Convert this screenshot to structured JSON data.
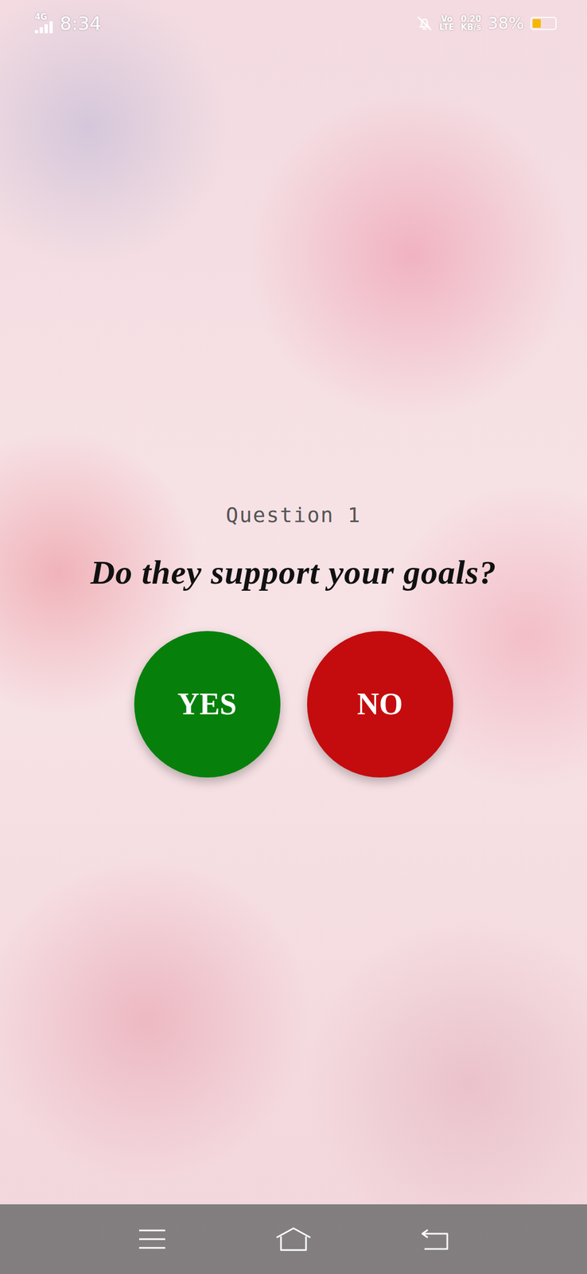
{
  "status_bar": {
    "network": "4G",
    "signal_level": 1,
    "time": "8:34",
    "volte": [
      "Vo",
      "LTE"
    ],
    "speed": [
      "0.20",
      "KB/s"
    ],
    "battery": "38%",
    "battery_level": 0.38
  },
  "question": {
    "label": "Question 1",
    "text": "Do they support your goals?"
  },
  "buttons": [
    {
      "label": "YES",
      "color": "#07800b"
    },
    {
      "label": "NO",
      "color": "#c40c0e"
    }
  ]
}
